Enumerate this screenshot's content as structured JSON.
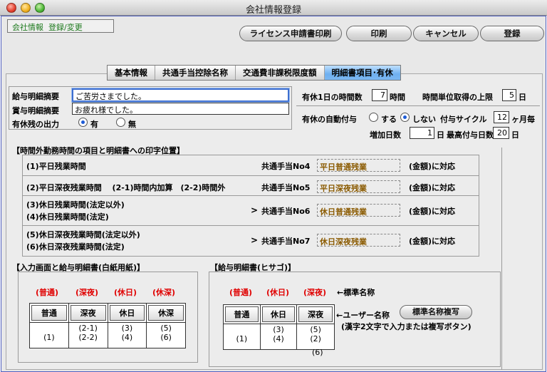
{
  "window": {
    "title": "会社情報登録"
  },
  "mode_label": "会社情報  登録/変更",
  "toolbar": {
    "license_print": "ライセンス申請書印刷",
    "print": "印刷",
    "cancel": "キャンセル",
    "register": "登録"
  },
  "tabs": [
    {
      "label": "基本情報"
    },
    {
      "label": "共通手当控除名称"
    },
    {
      "label": "交通費非課税限度額"
    },
    {
      "label": "明細書項目･有休"
    }
  ],
  "form": {
    "salary_summary_label": "給与明細摘要",
    "salary_summary_value": "ご苦労さまでした。",
    "bonus_summary_label": "賞与明細摘要",
    "bonus_summary_value": "お疲れ様でした。",
    "leave_output_label": "有休残の出力",
    "leave_output_yes": "有",
    "leave_output_no": "無",
    "hours_per_day_label": "有休1日の時間数",
    "hours_per_day_value": "7",
    "hours_unit": "時間",
    "hourly_limit_label": "時間単位取得の上限",
    "hourly_limit_value": "5",
    "days_unit": "日",
    "auto_grant_label": "有休の自動付与",
    "auto_grant_yes": "する",
    "auto_grant_no": "しない",
    "grant_cycle_label": "付与サイクル",
    "grant_cycle_value": "12",
    "grant_cycle_unit": "ヶ月毎",
    "increase_days_label": "増加日数",
    "increase_days_value": "1",
    "max_grant_label": "最高付与日数",
    "max_grant_value": "20"
  },
  "overtime": {
    "title": "【時間外勤務時間の項目と明細書への印字位置】",
    "rows": [
      {
        "lines": [
          "(1)平日残業時間"
        ],
        "allowance": "共通手当No4",
        "name": "平日普通残業",
        "note": "(金額)に対応",
        "arrow": ""
      },
      {
        "lines": [
          "(2)平日深夜残業時間　 (2-1)時間内加算　(2-2)時間外"
        ],
        "allowance": "共通手当No5",
        "name": "平日深夜残業",
        "note": "(金額)に対応",
        "arrow": ""
      },
      {
        "lines": [
          "(3)休日残業時間(法定以外)",
          "(4)休日残業時間(法定)"
        ],
        "allowance": "共通手当No6",
        "name": "休日普通残業",
        "note": "(金額)に対応",
        "arrow": ">"
      },
      {
        "lines": [
          "(5)休日深夜残業時間(法定以外)",
          "(6)休日深夜残業時間(法定)"
        ],
        "allowance": "共通手当No7",
        "name": "休日深夜残業",
        "note": "(金額)に対応",
        "arrow": ">"
      }
    ]
  },
  "input_section": {
    "title": "【入力画面と給与明細書(白紙用紙)】",
    "reds": [
      "(普通)",
      "(深夜)",
      "(休日)",
      "(休深)"
    ],
    "headers": [
      "普通",
      "深夜",
      "休日",
      "休深"
    ],
    "cells": [
      "(1)",
      "(2-1)\n(2-2)",
      "(3)\n(4)",
      "(5)\n(6)"
    ]
  },
  "hisago_section": {
    "title": "【給与明細書(ヒサゴ)】",
    "reds": [
      "(普通)",
      "(休日)",
      "(深夜)"
    ],
    "standard_note": "←標準名称",
    "headers": [
      "普通",
      "休日",
      "深夜"
    ],
    "user_note": "←ユーザー名称",
    "copy_button": "標準名称複写",
    "hint": "(漢字2文字で入力または複写ボタン)",
    "cells": [
      "(1)",
      "(3)\n(4)",
      "(5)\n(2)"
    ],
    "extra": "(6)"
  }
}
